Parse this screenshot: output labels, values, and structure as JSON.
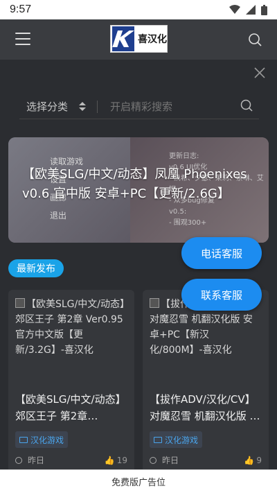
{
  "status_bar": {
    "time": "9:57"
  },
  "header": {
    "logo_text": "喜汉化",
    "menu_icon": "hamburger-menu-icon",
    "search_icon": "search-icon"
  },
  "search": {
    "category_label": "选择分类",
    "placeholder": "开启精彩搜索"
  },
  "banner": {
    "title": "【欧美SLG/中文/动态】凤凰 Phoenixes v0.6 官中版 安卓+PC【更新/2.6G】",
    "menu_items": [
      "读取游戏",
      "设置",
      "画廊",
      "退出"
    ],
    "side_notes": [
      "更新日志:",
      "v0.6 UI优化",
      "- 凯希、夕瑟、茉莉、索琳、艾妮",
      "- 众多bug修复",
      "v0.5:",
      "- 围观300+"
    ]
  },
  "floating": {
    "phone_label": "电话客服",
    "contact_label": "联系客服"
  },
  "section": {
    "latest_label": "最新发布"
  },
  "cards": [
    {
      "alt": "【欧美SLG/中文/动态】郊区王子 第2章 Ver0.95 官方中文版【更新/3.2G】-喜汉化",
      "title": "【欧美SLG/中文/动态】郊区王子 第2章 Ver0.95 官方中文版【更新/3.2G】",
      "tag": "汉化游戏",
      "date": "昨日",
      "likes": "19"
    },
    {
      "alt": "【拔作ADV/汉化/CV】对魔忍雪 机翻汉化版 安卓+PC【新汉化/800M】-喜汉化",
      "title": "【拔作ADV/汉化/CV】对魔忍雪 机翻汉化版 安卓+PC【新汉化/800M】",
      "tag": "汉化游戏",
      "date": "昨日",
      "likes": "9"
    }
  ],
  "ad_bar": {
    "label": "免费版广告位"
  },
  "colors": {
    "accent": "#1c8cf0",
    "badge": "#1aa3e8",
    "background": "#2b2d31",
    "tag_text": "#4aa6ee"
  }
}
